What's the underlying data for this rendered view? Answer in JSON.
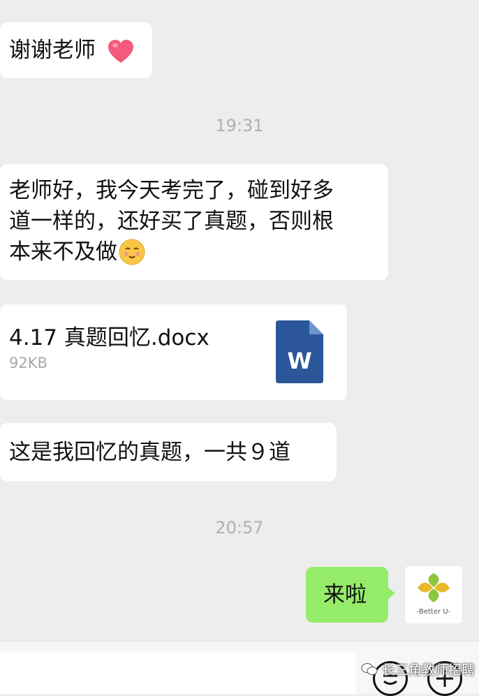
{
  "messages": {
    "m1": "谢谢老师",
    "time1": "19:31",
    "m2_line1": "老师好，我今天考完了，碰到好多",
    "m2_line2": "道一样的，还好买了真题，否则根",
    "m2_line3": "本来不及做",
    "file_name": "4.17 真题回忆.docx",
    "file_size": "92KB",
    "file_icon_letter": "W",
    "m3": "这是我回忆的真题，一共９道",
    "time2": "20:57",
    "m4": "来啦"
  },
  "avatar": {
    "text": "-Better U-"
  },
  "watermark": {
    "text": "长三角教师招聘"
  },
  "colors": {
    "sent_bubble": "#95ec69",
    "word_icon": "#2b579a",
    "heart": "#f25b7b"
  },
  "icons": [
    "heart-emoji-icon",
    "smile-emoji-icon",
    "word-file-icon",
    "emoji-button-icon",
    "plus-icon",
    "wechat-icon"
  ]
}
